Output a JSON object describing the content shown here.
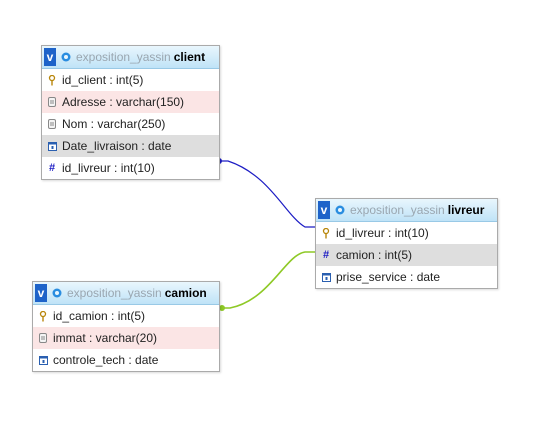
{
  "tables": {
    "client": {
      "db": "exposition_yassin",
      "name": "client",
      "toggle": "v",
      "rows": [
        {
          "label": "id_client : int(5)",
          "icon": "key-icon",
          "style": "plain"
        },
        {
          "label": "Adresse : varchar(150)",
          "icon": "text-field-icon",
          "style": "pink"
        },
        {
          "label": "Nom : varchar(250)",
          "icon": "text-field-icon",
          "style": "plain"
        },
        {
          "label": "Date_livraison : date",
          "icon": "date-field-icon",
          "style": "grey"
        },
        {
          "label": "id_livreur : int(10)",
          "icon": "numeric-field-icon",
          "style": "plain"
        }
      ]
    },
    "livreur": {
      "db": "exposition_yassin",
      "name": "livreur",
      "toggle": "v",
      "rows": [
        {
          "label": "id_livreur : int(10)",
          "icon": "key-icon",
          "style": "plain"
        },
        {
          "label": "camion : int(5)",
          "icon": "numeric-field-icon",
          "style": "grey"
        },
        {
          "label": "prise_service : date",
          "icon": "date-field-icon",
          "style": "plain"
        }
      ]
    },
    "camion": {
      "db": "exposition_yassin",
      "name": "camion",
      "toggle": "v",
      "rows": [
        {
          "label": "id_camion : int(5)",
          "icon": "key-icon",
          "style": "plain"
        },
        {
          "label": "immat : varchar(20)",
          "icon": "text-field-icon",
          "style": "pink"
        },
        {
          "label": "controle_tech : date",
          "icon": "date-field-icon",
          "style": "plain"
        }
      ]
    }
  },
  "relations": [
    {
      "from": "client.id_livreur",
      "to": "livreur.id_livreur",
      "color": "#1c1cc4"
    },
    {
      "from": "camion.id_camion",
      "to": "livreur.camion",
      "color": "#8ec926"
    }
  ],
  "colors": {
    "header_db": "#9aa6b0",
    "pink_row": "#fbe5e5",
    "grey_row": "#dedede",
    "toggle": "#1e63c9"
  }
}
